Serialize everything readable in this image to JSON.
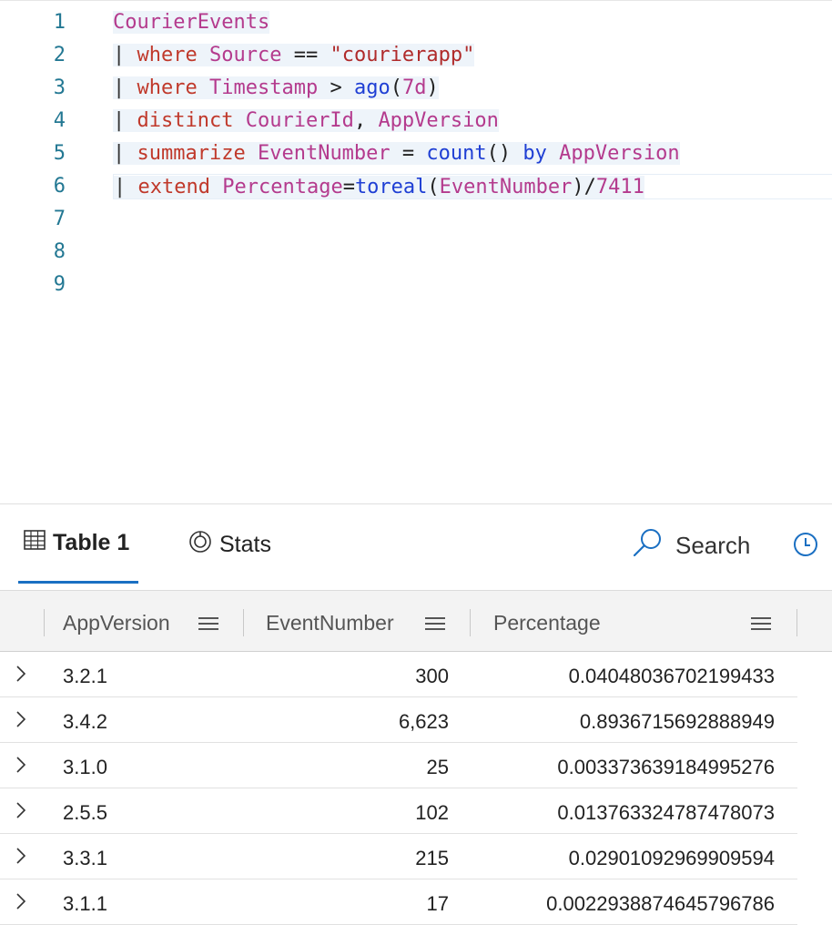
{
  "editor": {
    "lines": [
      {
        "num": "1",
        "tokens": [
          {
            "t": "CourierEvents",
            "c": "tbl"
          }
        ]
      },
      {
        "num": "2",
        "tokens": [
          {
            "t": "| ",
            "c": "pipe"
          },
          {
            "t": "where",
            "c": "kw"
          },
          {
            "t": " ",
            "c": "op"
          },
          {
            "t": "Source",
            "c": "col"
          },
          {
            "t": " == ",
            "c": "op"
          },
          {
            "t": "\"courierapp\"",
            "c": "str"
          }
        ]
      },
      {
        "num": "3",
        "tokens": [
          {
            "t": "| ",
            "c": "pipe"
          },
          {
            "t": "where",
            "c": "kw"
          },
          {
            "t": " ",
            "c": "op"
          },
          {
            "t": "Timestamp",
            "c": "col"
          },
          {
            "t": " > ",
            "c": "op"
          },
          {
            "t": "ago",
            "c": "fn"
          },
          {
            "t": "(",
            "c": "op"
          },
          {
            "t": "7d",
            "c": "num"
          },
          {
            "t": ")",
            "c": "op"
          }
        ]
      },
      {
        "num": "4",
        "tokens": [
          {
            "t": "| ",
            "c": "pipe"
          },
          {
            "t": "distinct",
            "c": "kw"
          },
          {
            "t": " ",
            "c": "op"
          },
          {
            "t": "CourierId",
            "c": "col"
          },
          {
            "t": ", ",
            "c": "op"
          },
          {
            "t": "AppVersion",
            "c": "col"
          }
        ]
      },
      {
        "num": "5",
        "tokens": [
          {
            "t": "| ",
            "c": "pipe"
          },
          {
            "t": "summarize",
            "c": "kw"
          },
          {
            "t": " ",
            "c": "op"
          },
          {
            "t": "EventNumber",
            "c": "col"
          },
          {
            "t": " = ",
            "c": "op"
          },
          {
            "t": "count",
            "c": "fn"
          },
          {
            "t": "() ",
            "c": "op"
          },
          {
            "t": "by",
            "c": "fn"
          },
          {
            "t": " ",
            "c": "op"
          },
          {
            "t": "AppVersion",
            "c": "col"
          }
        ]
      },
      {
        "num": "6",
        "tokens": [
          {
            "t": "| ",
            "c": "pipe"
          },
          {
            "t": "extend",
            "c": "kw"
          },
          {
            "t": " ",
            "c": "op"
          },
          {
            "t": "Percentage",
            "c": "col"
          },
          {
            "t": "=",
            "c": "op"
          },
          {
            "t": "toreal",
            "c": "fn"
          },
          {
            "t": "(",
            "c": "op"
          },
          {
            "t": "EventNumber",
            "c": "col"
          },
          {
            "t": ")/",
            "c": "op"
          },
          {
            "t": "7411",
            "c": "num"
          }
        ]
      },
      {
        "num": "7",
        "tokens": []
      },
      {
        "num": "8",
        "tokens": []
      },
      {
        "num": "9",
        "tokens": []
      }
    ]
  },
  "results": {
    "tabs": [
      {
        "label": "Table 1",
        "icon": "table-icon",
        "active": true
      },
      {
        "label": "Stats",
        "icon": "stats-icon",
        "active": false
      }
    ],
    "search_label": "Search",
    "history_icon": "clock-icon"
  },
  "grid": {
    "columns": [
      {
        "label": "AppVersion"
      },
      {
        "label": "EventNumber"
      },
      {
        "label": "Percentage"
      }
    ],
    "rows": [
      {
        "app": "3.2.1",
        "events": "300",
        "pct": "0.04048036702199433"
      },
      {
        "app": "3.4.2",
        "events": "6,623",
        "pct": "0.8936715692888949"
      },
      {
        "app": "3.1.0",
        "events": "25",
        "pct": "0.003373639184995276"
      },
      {
        "app": "2.5.5",
        "events": "102",
        "pct": "0.01376332478747807​3"
      },
      {
        "app": "3.3.1",
        "events": "215",
        "pct": "0.02901092969909594"
      },
      {
        "app": "3.1.1",
        "events": "17",
        "pct": "0.002293887464579678​6"
      }
    ]
  },
  "colors": {
    "accent": "#1a6fc2",
    "line_number": "#237893",
    "keyword": "#c0392b",
    "identifier": "#b43a8d",
    "function": "#1f3fd4"
  }
}
